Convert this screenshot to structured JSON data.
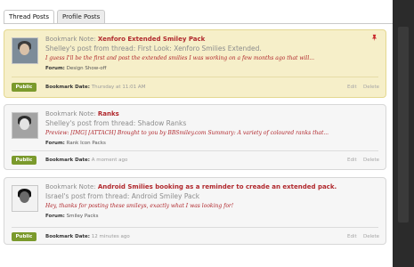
{
  "tabs": [
    {
      "label": "Thread Posts",
      "active": true
    },
    {
      "label": "Profile Posts",
      "active": false
    }
  ],
  "bookmarks": [
    {
      "note_label": "Bookmark Note:",
      "note_title": "Xenforo Extended Smiley Pack",
      "subtitle": "Shelley's post from thread: First Look: Xenforo Smilies Extended.",
      "excerpt": "I guess I'll be the first and post the extended smilies I was working on a few months ago that will...",
      "forum_label": "Forum:",
      "forum": "Design Show-off",
      "visibility": "Public",
      "date_label": "Bookmark Date:",
      "date": "Thursday at 11:01 AM",
      "edit": "Edit",
      "delete": "Delete"
    },
    {
      "note_label": "Bookmark Note:",
      "note_title": "Ranks",
      "subtitle": "Shelley's post from thread: Shadow Ranks",
      "excerpt": "Preview: [IMG] [ATTACH] Brought to you by BBSmiley.com Summary: A variety of coloured ranks that...",
      "forum_label": "Forum:",
      "forum": "Rank Icon Packs",
      "visibility": "Public",
      "date_label": "Bookmark Date:",
      "date": "A moment ago",
      "edit": "Edit",
      "delete": "Delete"
    },
    {
      "note_label": "Bookmark Note:",
      "note_title": "Android Smilies booking as a reminder to creade an extended pack.",
      "subtitle": "Israel's post from thread: Android Smiley Pack",
      "excerpt": "Hey, thanks for posting these smileys, exactly what I was looking for!",
      "forum_label": "Forum:",
      "forum": "Smiley Packs",
      "visibility": "Public",
      "date_label": "Bookmark Date:",
      "date": "12 minutes ago",
      "edit": "Edit",
      "delete": "Delete"
    }
  ],
  "colors": {
    "accent_red": "#b0272c",
    "public_green": "#7b9a2c",
    "highlight_bg": "#f6efc9"
  },
  "icons": {
    "pin": "pin-icon"
  }
}
